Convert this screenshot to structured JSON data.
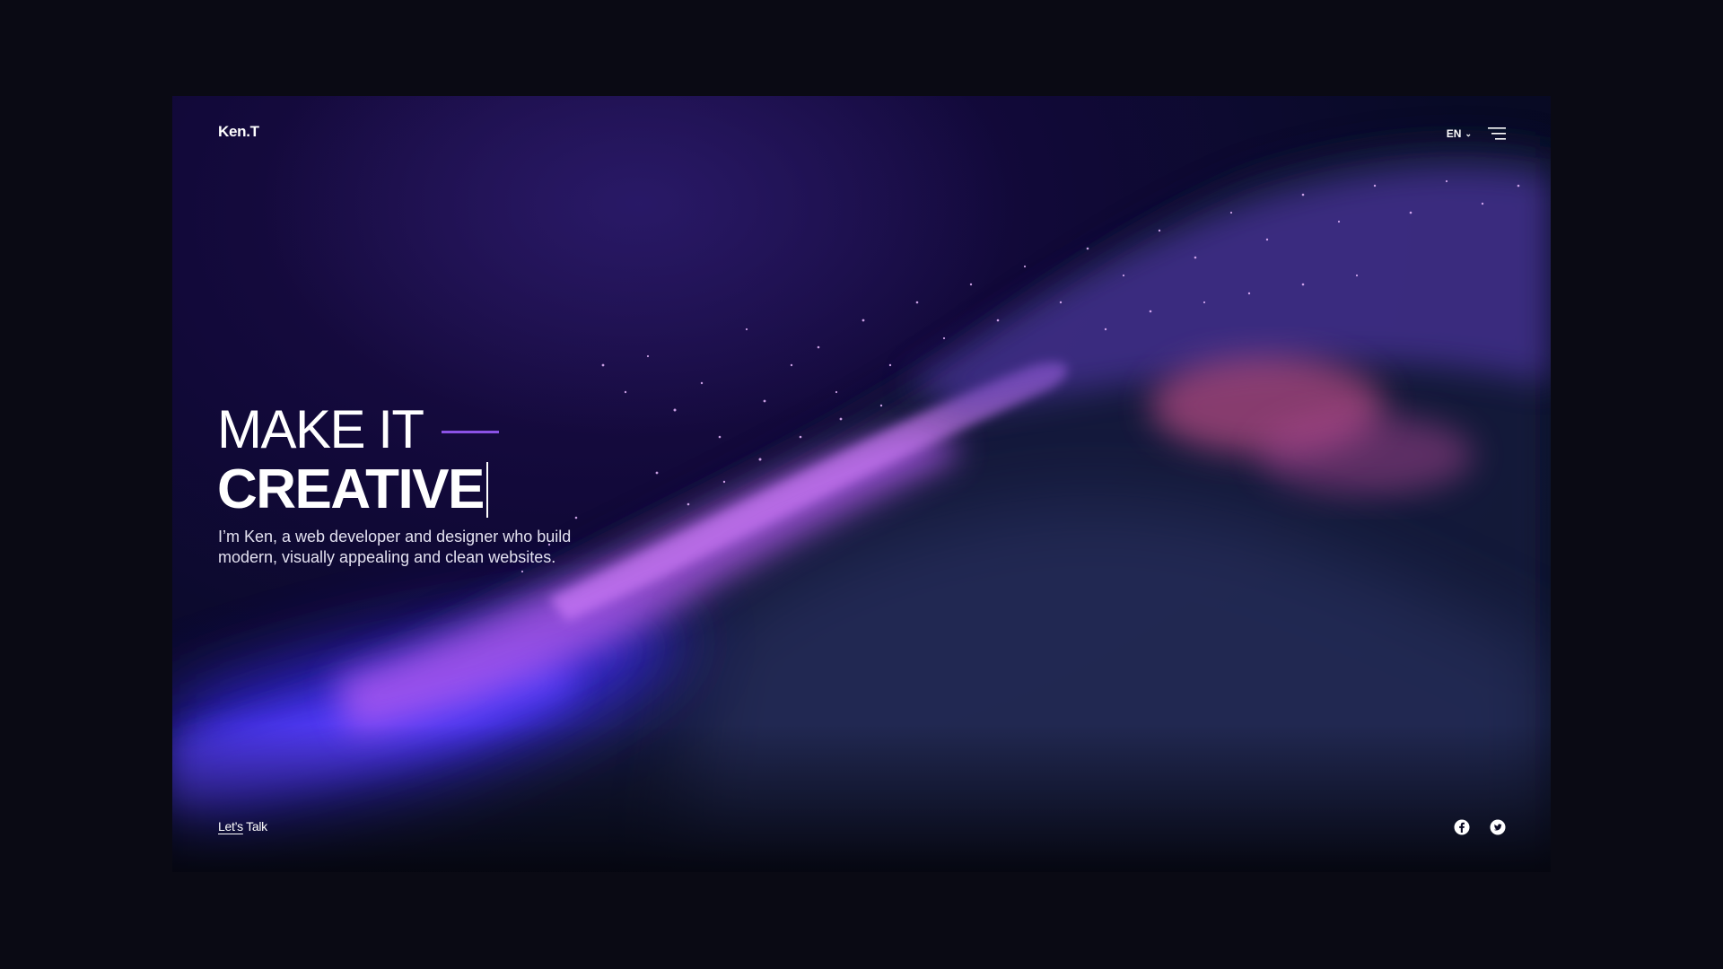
{
  "brand": {
    "logo": "Ken.T"
  },
  "header": {
    "language": "EN",
    "language_icon": "chevron-down-icon",
    "menu_icon": "hamburger-menu-icon"
  },
  "hero": {
    "line1": "MAKE IT",
    "line2": "CREATIVE",
    "intro_line1": "I’m Ken, a web developer and designer who build",
    "intro_line2": "modern, visually appealing and clean websites."
  },
  "footer": {
    "cta_part1": "Let’s",
    "cta_part2": " Talk",
    "social_icons": [
      "facebook-icon",
      "twitter-icon"
    ]
  },
  "colors": {
    "accent": "#8b52e6",
    "outer_background": "#0a0a14",
    "hero_background": "#0f0a30"
  }
}
